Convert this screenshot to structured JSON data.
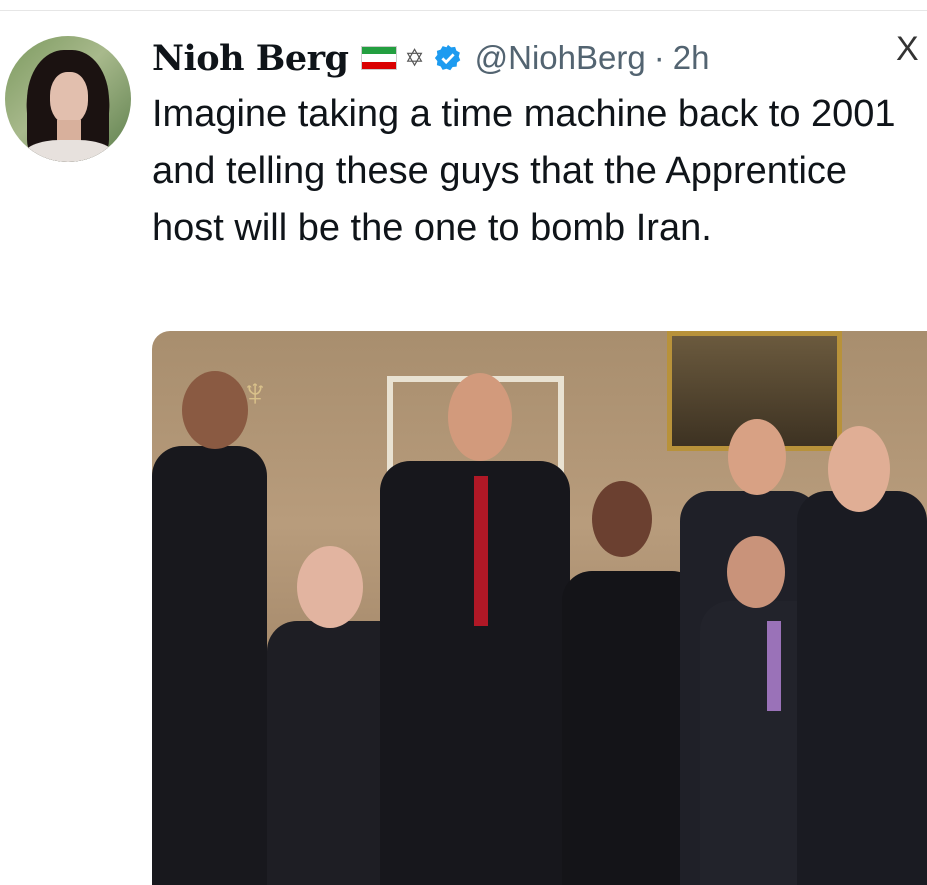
{
  "tweet": {
    "display_name": "Nioh Berg",
    "handle": "@NiohBerg",
    "separator": "·",
    "time": "2h",
    "text": "Imagine taking a time machine back to 2001 and telling these guys that the Apprentice host will be the one to bomb Iran.",
    "badges": [
      "iran-lion-sun-flag-icon",
      "star-of-david-icon",
      "verified-badge-icon"
    ],
    "colors": {
      "verified": "#1d9bf0",
      "flag_green": "#239f40",
      "flag_white": "#ffffff",
      "flag_red": "#da0000"
    }
  }
}
